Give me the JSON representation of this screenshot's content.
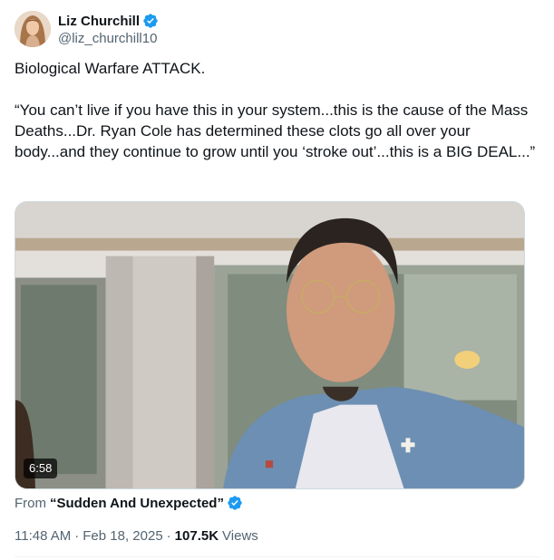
{
  "author": {
    "display_name": "Liz Churchill",
    "handle": "@liz_churchill10",
    "verified_icon": "verified-badge-icon",
    "accent": "#1d9bf0"
  },
  "tweet": {
    "line1": "Biological Warfare ATTACK.",
    "line2": "“You can’t live if you have this in your system...this is the cause of the Mass Deaths...Dr. Ryan Cole has determined these clots go all over your body...and they continue to grow until you ‘stroke out’...this is a BIG DEAL...”"
  },
  "media": {
    "duration": "6:58"
  },
  "source": {
    "from_label": "From",
    "name": "“Sudden And Unexpected”"
  },
  "meta": {
    "time": "11:48 AM",
    "date": "Feb 18, 2025",
    "views_count": "107.5K",
    "views_label": "Views"
  }
}
